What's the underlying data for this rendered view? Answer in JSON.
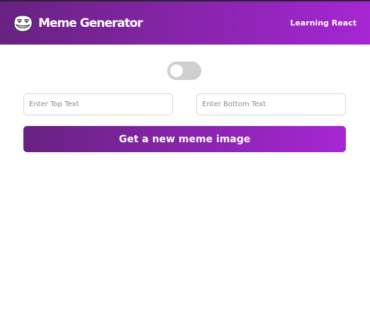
{
  "header": {
    "logo_icon": "troll-face-icon",
    "title": "Meme Generator",
    "right_text": "Learning React"
  },
  "colors": {
    "gradient_start": "#672280",
    "gradient_end": "#A626D3",
    "toggle_track": "#cfcfcf"
  },
  "main": {
    "toggle": {
      "state": "off"
    },
    "top_text": {
      "placeholder": "Enter Top Text",
      "value": ""
    },
    "bottom_text": {
      "placeholder": "Enter Bottom Text",
      "value": ""
    },
    "generate_button_label": "Get a new meme image"
  }
}
